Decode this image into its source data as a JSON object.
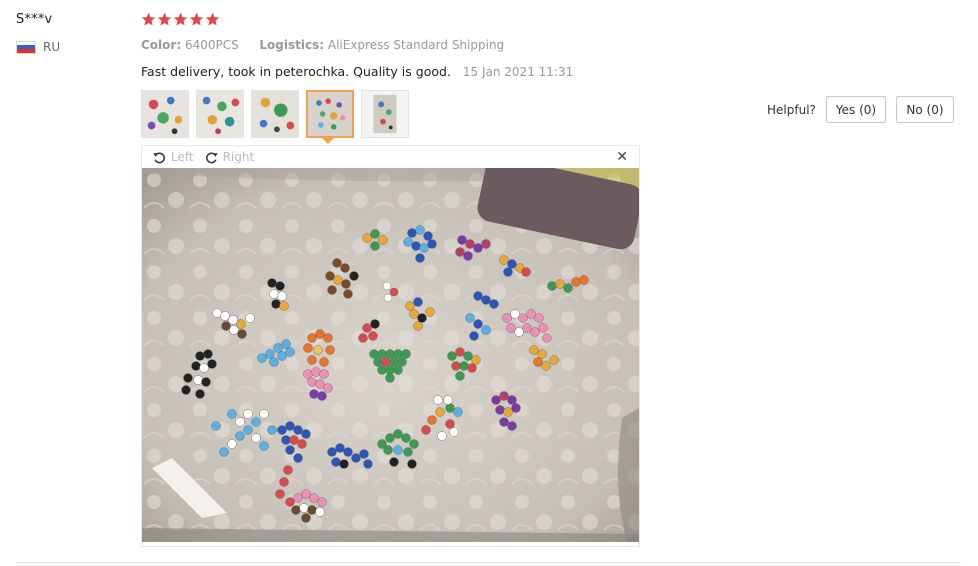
{
  "reviewer": {
    "name": "S***v",
    "country": "RU"
  },
  "rating": {
    "stars": 5,
    "color": "#e64545"
  },
  "meta": {
    "color_label": "Color:",
    "color_value": "6400PCS",
    "logistics_label": "Logistics:",
    "logistics_value": "AliExpress Standard Shipping"
  },
  "review": {
    "text": "Fast delivery, took in peterochka. Quality is good.",
    "date": "15 Jan 2021 11:31"
  },
  "viewer": {
    "rotate_left": "Left",
    "rotate_right": "Right",
    "close": "✕"
  },
  "feedback": {
    "label": "Helpful?",
    "yes": "Yes (0)",
    "no": "No (0)"
  },
  "theme": {
    "accent": "#f5a04c"
  }
}
